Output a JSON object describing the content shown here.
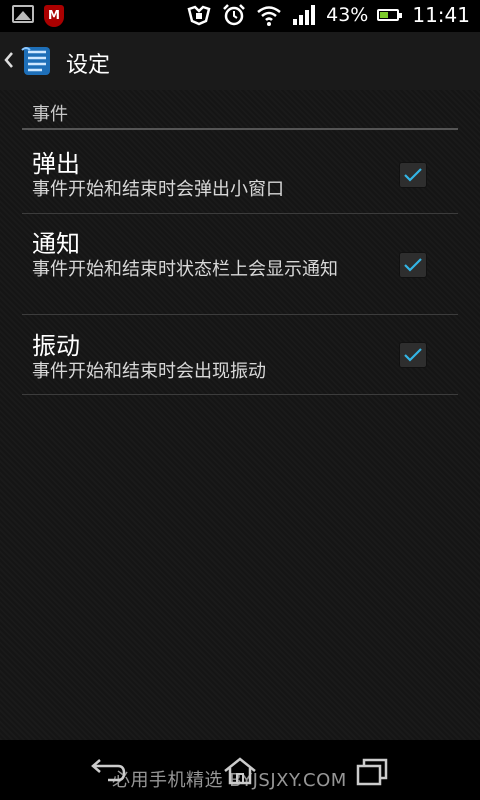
{
  "status_bar": {
    "battery_percent": "43%",
    "time": "11:41",
    "icons": [
      "image-icon",
      "mcafee-icon",
      "usb-icon",
      "alarm-icon",
      "wifi-icon",
      "signal-icon",
      "battery-icon"
    ],
    "mcafee_letter": "M"
  },
  "header": {
    "title": "设定"
  },
  "section": {
    "title": "事件"
  },
  "preferences": [
    {
      "title": "弹出",
      "summary": "事件开始和结束时会弹出小窗口",
      "checked": true
    },
    {
      "title": "通知",
      "summary": "事件开始和结束时状态栏上会显示通知",
      "checked": true
    },
    {
      "title": "振动",
      "summary": "事件开始和结束时会出现振动",
      "checked": true
    }
  ],
  "navbar": {
    "watermark": "必用手机精选 BYJSJXY.COM"
  },
  "colors": {
    "check_accent": "#33b5e5",
    "battery_fill": "#7ccb2a"
  }
}
